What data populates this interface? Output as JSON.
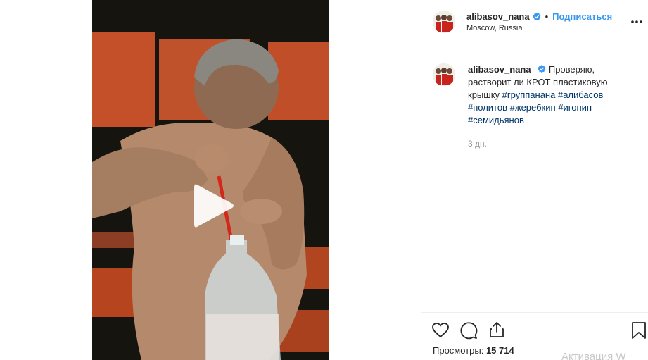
{
  "post": {
    "author": {
      "username": "alibasov_nana",
      "location": "Moscow, Russia",
      "verified": true
    },
    "header": {
      "follow_label": "Подписаться",
      "separator": "•"
    },
    "caption": {
      "text": "Проверяю, растворит ли КРОТ пластиковую крышку",
      "hashtags": [
        "#группанана",
        "#алибасов",
        "#политов",
        "#жеребкин",
        "#игонин",
        "#семидьянов"
      ]
    },
    "age": "3 дн.",
    "views": {
      "label": "Просмотры:",
      "count": "15 714"
    }
  },
  "system_overlay": {
    "watermark": "Активация W"
  },
  "colors": {
    "link_blue": "#3897f0",
    "hashtag": "#003569",
    "verified_badge": "#3897f0",
    "muted": "#999999"
  },
  "icons": [
    "verified-badge-icon",
    "more-options-icon",
    "heart-icon",
    "comment-icon",
    "share-icon",
    "bookmark-icon",
    "play-icon"
  ]
}
